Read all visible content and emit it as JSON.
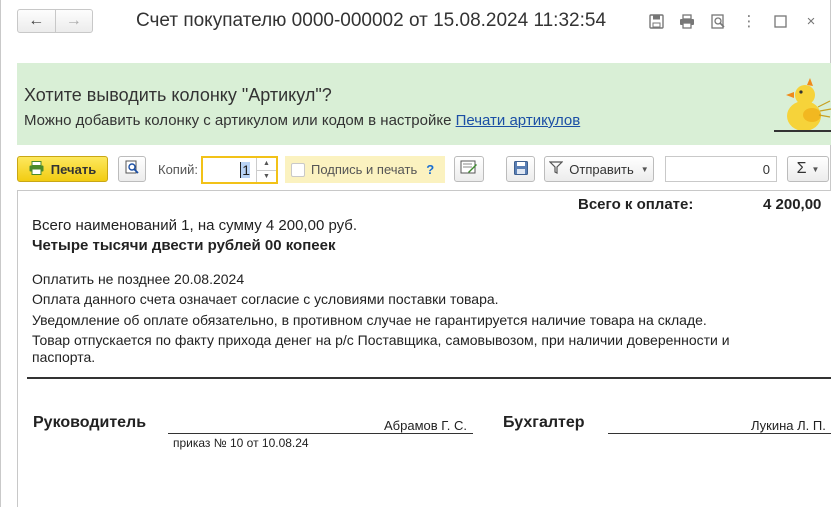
{
  "window": {
    "title": "Счет покупателю 0000-000002 от 15.08.2024 11:32:54",
    "nav_back": "←",
    "nav_forward": "→",
    "icons": [
      "save-icon",
      "print-icon",
      "preview-icon",
      "more-icon",
      "maximize-icon",
      "close-icon"
    ]
  },
  "banner": {
    "title": "Хотите выводить колонку \"Артикул\"?",
    "text": "Можно добавить колонку с артикулом или кодом в настройке ",
    "link": "Печати артикулов",
    "background": "#d9efd6"
  },
  "toolbar": {
    "print_label": "Печать",
    "copies_label": "Копий:",
    "copies_value": "1",
    "sign_label": "Подпись и печать",
    "sign_help": "?",
    "send_label": "Отправить",
    "sum_value": "0",
    "sigma_label": "Σ",
    "print_color": "#f2cc12"
  },
  "document": {
    "total_label": "Всего к оплате:",
    "total_value": "4 200,00",
    "summary": "Всего наименований 1, на сумму 4 200,00 руб.",
    "amount_words": "Четыре тысячи двести рублей 00 копеек",
    "notes": [
      "Оплатить не позднее 20.08.2024",
      "Оплата данного счета означает согласие с условиями поставки товара.",
      "Уведомление об оплате обязательно, в противном случае не гарантируется наличие товара на складе.",
      "Товар отпускается по факту прихода денег на р/с Поставщика, самовывозом, при наличии доверенности и",
      "паспорта."
    ],
    "signatures": {
      "head_label": "Руководитель",
      "head_name": "Абрамов Г. С.",
      "head_order": "приказ № 10 от 10.08.24",
      "accountant_label": "Бухгалтер",
      "accountant_name": "Лукина Л. П."
    }
  }
}
